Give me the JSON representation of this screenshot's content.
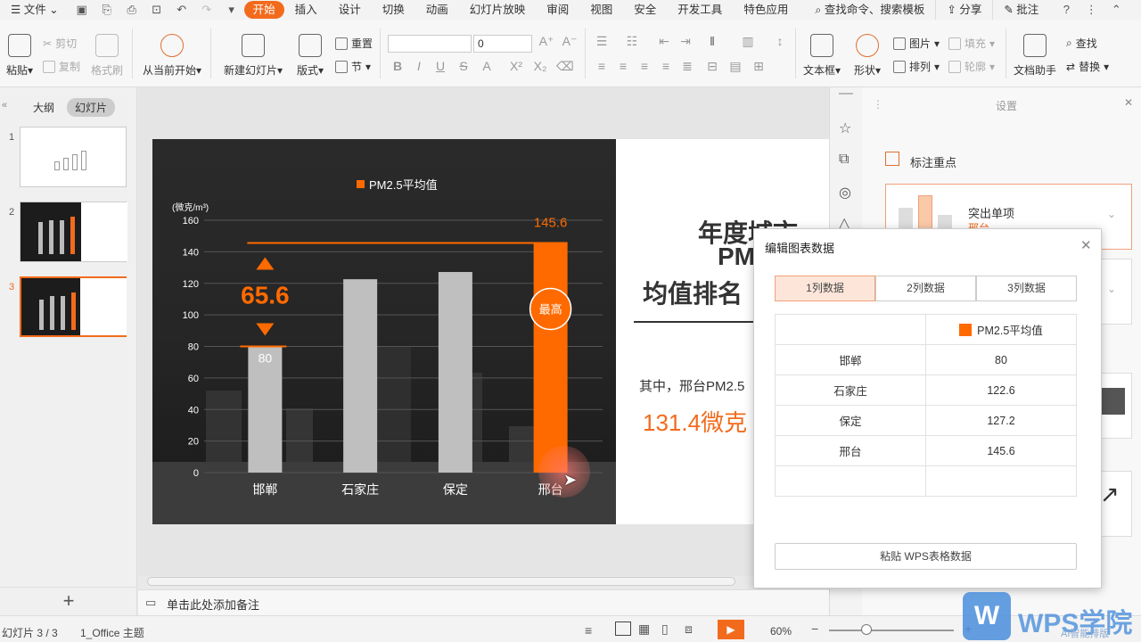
{
  "menubar": {
    "menu_label": "文件",
    "active_tab": "开始",
    "tabs": [
      "插入",
      "设计",
      "切换",
      "动画",
      "幻灯片放映",
      "审阅",
      "视图",
      "安全",
      "开发工具",
      "特色应用"
    ],
    "search": "查找命令、搜索模板",
    "share": "分享",
    "comment": "批注"
  },
  "ribbon": {
    "paste": "粘贴",
    "cut": "剪切",
    "copy": "复制",
    "format_painter": "格式刷",
    "from_start": "从当前开始",
    "new_slide": "新建幻灯片",
    "layout": "版式",
    "reset": "重置",
    "section": "节",
    "font_size": "0",
    "textbox": "文本框",
    "shape": "形状",
    "picture": "图片",
    "fill": "填充",
    "arrange": "排列",
    "outline": "轮廓",
    "doc_helper": "文档助手",
    "find": "查找",
    "replace": "替换"
  },
  "left_panel": {
    "tab_outline": "大纲",
    "tab_slides": "幻灯片",
    "slide_numbers": [
      "1",
      "2",
      "3"
    ],
    "add_label": "+"
  },
  "slide": {
    "legend": "PM2.5平均值",
    "y_unit": "(微克/m³)",
    "diff_label": "65.6",
    "max_badge": "最高",
    "title_line1": "年度城市",
    "title_line2": "PM",
    "title_line3": "均值排名",
    "body_text": "其中，邢台PM2.5",
    "highlight": "131.4微克"
  },
  "chart_data": {
    "type": "bar",
    "categories": [
      "邯郸",
      "石家庄",
      "保定",
      "邢台"
    ],
    "series": [
      {
        "name": "PM2.5平均值",
        "values": [
          80,
          122.6,
          127.2,
          145.6
        ]
      }
    ],
    "ylabel": "(微克/m³)",
    "ylim": [
      0,
      160
    ],
    "yticks": [
      "0",
      "20",
      "40",
      "60",
      "80",
      "100",
      "120",
      "140",
      "160"
    ],
    "data_labels": [
      "80",
      "",
      "",
      "145.6"
    ],
    "highlight_color": "#ff6a00",
    "bar_color": "#bfbfbf"
  },
  "dialog": {
    "title": "编辑图表数据",
    "tabs": [
      "1列数据",
      "2列数据",
      "3列数据"
    ],
    "column_header": "PM2.5平均值",
    "rows": [
      [
        "邯郸",
        "80"
      ],
      [
        "石家庄",
        "122.6"
      ],
      [
        "保定",
        "127.2"
      ],
      [
        "邢台",
        "145.6"
      ]
    ],
    "paste_button": "粘贴 WPS表格数据"
  },
  "settings": {
    "title": "设置",
    "section": "标注重点",
    "option1": "突出单项",
    "option1_sub": "邢台"
  },
  "notebar": {
    "placeholder": "单击此处添加备注"
  },
  "statusbar": {
    "slide_info": "幻灯片 3 / 3",
    "theme": "1_Office 主题",
    "zoom": "60%"
  },
  "watermark": {
    "brand": "WPS学院",
    "sub": "AI智能排版"
  }
}
